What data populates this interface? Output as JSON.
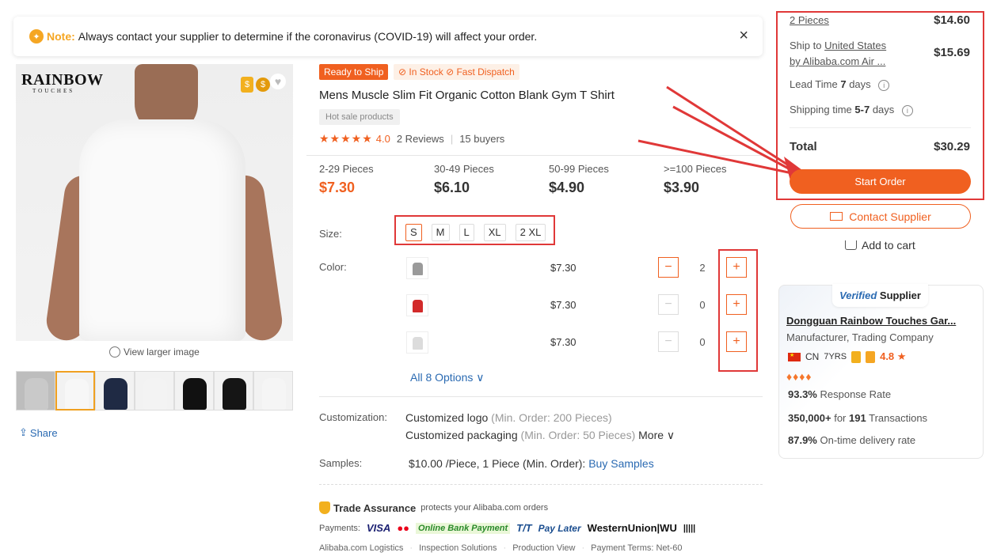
{
  "notice": {
    "icon": "lightbulb-icon",
    "label": "Note:",
    "text": "Always contact your supplier to determine if the coronavirus (COVID-19) will affect your order.",
    "close_icon": "×"
  },
  "gallery": {
    "logo_main": "RAINBOW",
    "logo_sub": "TOUCHES",
    "view_larger": "View larger image",
    "share": "Share",
    "thumb_colors": [
      "#c9c9c9",
      "#f7f7f7",
      "#1f2a44",
      "#f3f3f3",
      "#111111",
      "#151515",
      "#f5f5f5"
    ]
  },
  "product": {
    "tag_ready": "Ready to Ship",
    "tag_stock": "⊘ In Stock ⊘ Fast Dispatch",
    "title": "Mens Muscle Slim Fit Organic Cotton Blank Gym T Shirt",
    "hot_tag": "Hot sale products",
    "stars": "★★★★★",
    "rating": "4.0",
    "reviews": "2 Reviews",
    "buyers": "15 buyers"
  },
  "tiers": [
    {
      "qty": "2-29 Pieces",
      "price": "$7.30"
    },
    {
      "qty": "30-49 Pieces",
      "price": "$6.10"
    },
    {
      "qty": "50-99 Pieces",
      "price": "$4.90"
    },
    {
      "qty": ">=100 Pieces",
      "price": "$3.90"
    }
  ],
  "size": {
    "label": "Size:",
    "options": [
      "S",
      "M",
      "L",
      "XL",
      "2 XL"
    ],
    "selected": "S"
  },
  "color": {
    "label": "Color:",
    "rows": [
      {
        "swatch": "#9a9a9a",
        "price": "$7.30",
        "qty": "2"
      },
      {
        "swatch": "#d22a2a",
        "price": "$7.30",
        "qty": "0"
      },
      {
        "swatch": "#dcdcdc",
        "price": "$7.30",
        "qty": "0"
      }
    ],
    "all_options": "All 8 Options ∨"
  },
  "customization": {
    "label": "Customization:",
    "item1": "Customized logo",
    "item1_note": "(Min. Order: 200 Pieces)",
    "item2": "Customized packaging",
    "item2_note": "(Min. Order: 50 Pieces)",
    "more": "More ∨"
  },
  "samples": {
    "label": "Samples:",
    "text": "$10.00 /Piece, 1 Piece (Min. Order):",
    "link": "Buy Samples"
  },
  "trade": {
    "name": "Trade Assurance",
    "desc": "protects your Alibaba.com orders",
    "payments_label": "Payments:",
    "methods": [
      "VISA",
      "●●",
      "Online Bank Payment",
      "T/T",
      "Pay Later",
      "WesternUnion|WU",
      "|||||"
    ],
    "footer": [
      "Alibaba.com Logistics",
      "Inspection Solutions",
      "Production View",
      "Payment Terms: Net-60"
    ]
  },
  "order": {
    "pieces": "2 Pieces",
    "pieces_price": "$14.60",
    "ship_prefix": "Ship to",
    "ship_country": "United States",
    "ship_by": "by Alibaba.com Air ...",
    "ship_price": "$15.69",
    "lead_label": "Lead Time",
    "lead_value": "7",
    "lead_unit": "days",
    "shipping_label": "Shipping time",
    "shipping_value": "5-7",
    "shipping_unit": "days",
    "total_label": "Total",
    "total_value": "$30.29",
    "start_order": "Start Order",
    "contact": "Contact Supplier",
    "add_cart": "Add to cart"
  },
  "supplier": {
    "verified_v": "Verified",
    "verified_rest": "Supplier",
    "name": "Dongguan Rainbow Touches Gar...",
    "type": "Manufacturer, Trading Company",
    "country": "CN",
    "years": "7YRS",
    "rating": "4.8 ★",
    "diamonds": "♦♦♦♦",
    "response_rate": "93.3%",
    "response_label": "Response Rate",
    "volume": "350,000+",
    "volume_for": "for",
    "transactions": "191",
    "transactions_label": "Transactions",
    "ontime": "87.9%",
    "ontime_label": "On-time delivery rate"
  },
  "colors": {
    "accent": "#f06020",
    "link": "#2a6ab2",
    "highlight_red": "#e03838"
  }
}
